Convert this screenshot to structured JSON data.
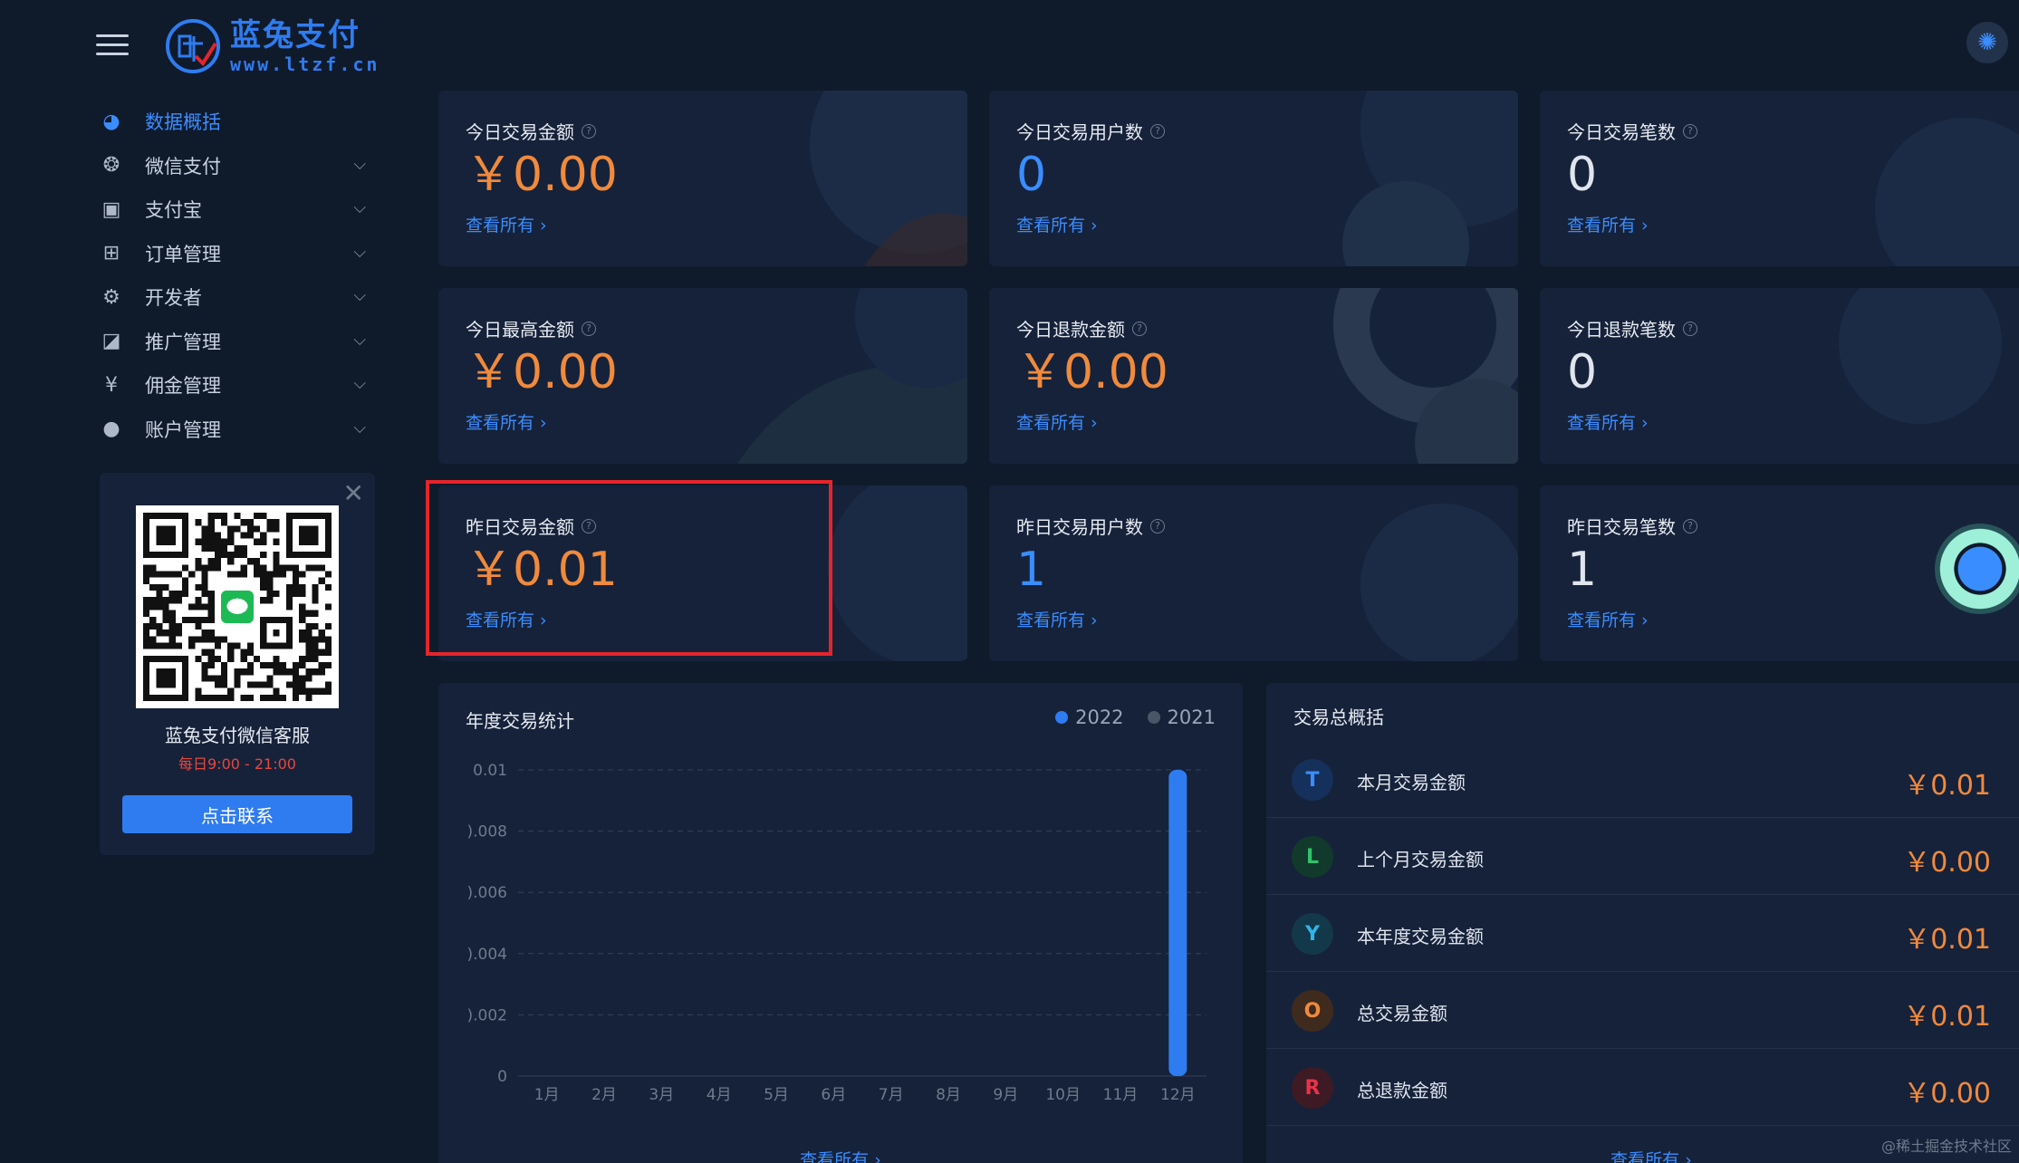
{
  "header": {
    "brand_title": "蓝兔支付",
    "brand_url": "www.ltzf.cn",
    "menu_icon": "hamburger-menu-icon",
    "theme_icon": "settings-gear-icon"
  },
  "sidebar": {
    "items": [
      {
        "label": "数据概括",
        "icon": "pie-chart-icon",
        "active": true
      },
      {
        "label": "微信支付",
        "icon": "wechat-icon",
        "active": false
      },
      {
        "label": "支付宝",
        "icon": "alipay-icon",
        "active": false
      },
      {
        "label": "订单管理",
        "icon": "table-icon",
        "active": false
      },
      {
        "label": "开发者",
        "icon": "developer-icon",
        "active": false
      },
      {
        "label": "推广管理",
        "icon": "share-icon",
        "active": false
      },
      {
        "label": "佣金管理",
        "icon": "yen-icon",
        "active": false
      },
      {
        "label": "账户管理",
        "icon": "user-icon",
        "active": false
      }
    ],
    "chevron_icon": "chevron-down-icon"
  },
  "support": {
    "name": "蓝兔支付微信客服",
    "hours": "每日9:00 - 21:00",
    "button": "点击联系",
    "close_icon": "close-icon"
  },
  "stats": [
    {
      "label": "今日交易金额",
      "value": "￥0.00",
      "link": "查看所有 ›",
      "color": "orange"
    },
    {
      "label": "今日交易用户数",
      "value": "0",
      "link": "查看所有 ›",
      "color": "blue"
    },
    {
      "label": "今日交易笔数",
      "value": "0",
      "link": "查看所有 ›",
      "color": "white"
    },
    {
      "label": "今日最高金额",
      "value": "￥0.00",
      "link": "查看所有 ›",
      "color": "orange"
    },
    {
      "label": "今日退款金额",
      "value": "￥0.00",
      "link": "查看所有 ›",
      "color": "orange"
    },
    {
      "label": "今日退款笔数",
      "value": "0",
      "link": "查看所有 ›",
      "color": "white"
    },
    {
      "label": "昨日交易金额",
      "value": "￥0.01",
      "link": "查看所有 ›",
      "color": "orange"
    },
    {
      "label": "昨日交易用户数",
      "value": "1",
      "link": "查看所有 ›",
      "color": "blue"
    },
    {
      "label": "昨日交易笔数",
      "value": "1",
      "link": "查看所有 ›",
      "color": "white"
    }
  ],
  "chart_panel": {
    "title": "年度交易统计",
    "link": "查看所有 ›"
  },
  "chart_data": {
    "type": "bar",
    "categories": [
      "1月",
      "2月",
      "3月",
      "4月",
      "5月",
      "6月",
      "7月",
      "8月",
      "9月",
      "10月",
      "11月",
      "12月"
    ],
    "series": [
      {
        "name": "2022",
        "color": "#2f7cf0",
        "values": [
          0,
          0,
          0,
          0,
          0,
          0,
          0,
          0,
          0,
          0,
          0,
          0.01
        ]
      },
      {
        "name": "2021",
        "color": "#4a5568",
        "values": [
          0,
          0,
          0,
          0,
          0,
          0,
          0,
          0,
          0,
          0,
          0,
          0
        ]
      }
    ],
    "yticks": [
      "0",
      ").002",
      ").004",
      ").006",
      ").008",
      "0.01"
    ],
    "ylim": [
      0,
      0.01
    ],
    "grid": true,
    "legend_position": "top-right"
  },
  "summary": {
    "title": "交易总概括",
    "link": "查看所有 ›",
    "rows": [
      {
        "letter": "T",
        "label": "本月交易金额",
        "value": "￥0.01",
        "bg": "#15305a",
        "fg": "#3a8dff"
      },
      {
        "letter": "L",
        "label": "上个月交易金额",
        "value": "￥0.00",
        "bg": "#123a2c",
        "fg": "#2ec46d"
      },
      {
        "letter": "Y",
        "label": "本年度交易金额",
        "value": "￥0.01",
        "bg": "#12384a",
        "fg": "#2fb4e8"
      },
      {
        "letter": "O",
        "label": "总交易金额",
        "value": "￥0.01",
        "bg": "#3f2b1e",
        "fg": "#f08a3c"
      },
      {
        "letter": "R",
        "label": "总退款金额",
        "value": "￥0.00",
        "bg": "#3d1a24",
        "fg": "#e8334a"
      }
    ]
  },
  "watermark": "@稀土掘金技术社区"
}
